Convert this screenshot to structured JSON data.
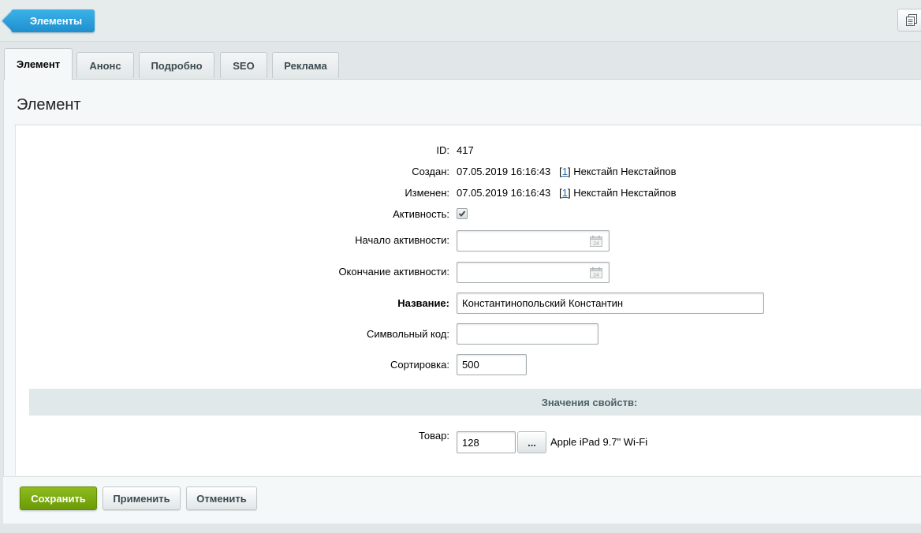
{
  "header": {
    "back_label": "Элементы"
  },
  "tabs": [
    {
      "label": "Элемент",
      "active": true
    },
    {
      "label": "Анонс"
    },
    {
      "label": "Подробно"
    },
    {
      "label": "SEO"
    },
    {
      "label": "Реклама"
    }
  ],
  "panel": {
    "title": "Элемент"
  },
  "fields": {
    "id": {
      "label": "ID:",
      "value": "417"
    },
    "created": {
      "label": "Создан:",
      "datetime": "07.05.2019 16:16:43",
      "user_link": "1",
      "user_name": "Некстайп Некстайпов"
    },
    "modified": {
      "label": "Изменен:",
      "datetime": "07.05.2019 16:16:43",
      "user_link": "1",
      "user_name": "Некстайп Некстайпов"
    },
    "active": {
      "label": "Активность:",
      "checked": true
    },
    "active_from": {
      "label": "Начало активности:",
      "value": ""
    },
    "active_to": {
      "label": "Окончание активности:",
      "value": ""
    },
    "name": {
      "label": "Название:",
      "value": "Константинопольский Константин"
    },
    "code": {
      "label": "Символьный код:",
      "value": ""
    },
    "sort": {
      "label": "Сортировка:",
      "value": "500"
    }
  },
  "properties": {
    "section_title": "Значения свойств:",
    "product": {
      "label": "Товар:",
      "value": "128",
      "browse_label": "...",
      "product_name": "Apple iPad 9.7\" Wi-Fi"
    }
  },
  "footer": {
    "save_label": "Сохранить",
    "apply_label": "Применить",
    "cancel_label": "Отменить"
  },
  "colors": {
    "accent_blue": "#1f8fce",
    "save_green": "#7aab10",
    "link": "#2067b0"
  }
}
